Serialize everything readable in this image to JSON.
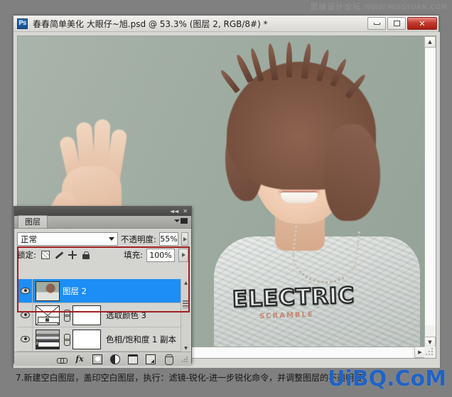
{
  "watermark_top": {
    "cn": "思缘设计论坛",
    "en": "WWW.MISSYUAN.COM"
  },
  "window": {
    "app_icon": "Ps",
    "title": "春春简单美化  大眼仔~旭.psd @ 53.3% (图层 2, RGB/8#) *",
    "controls": {
      "minimize": "minimize-button",
      "maximize": "maximize-button",
      "close": "✕"
    }
  },
  "document": {
    "zoom": "53.3%",
    "color_mode": "RGB/8#",
    "active_layer": "图层 2",
    "shirt_text": "ELECTRIC",
    "shirt_subtext": "SCRAMBLE"
  },
  "panel": {
    "tab_label": "图层",
    "collapse_icon": "◄◄",
    "close_icon": "✕",
    "blend_mode": "正常",
    "opacity_label": "不透明度:",
    "opacity_value": "55%",
    "lock_label": "锁定:",
    "fill_label": "填充:",
    "fill_value": "100%",
    "lock_icons": [
      "lock-transparent-pixels-icon",
      "lock-image-pixels-icon",
      "lock-position-icon",
      "lock-all-icon"
    ],
    "layers": [
      {
        "name": "图层 2",
        "visible": true,
        "selected": true,
        "kind": "pixel"
      },
      {
        "name": "选取颜色 3",
        "visible": true,
        "selected": false,
        "kind": "adjustment-selective-color"
      },
      {
        "name": "色相/饱和度 1 副本",
        "visible": true,
        "selected": false,
        "kind": "adjustment-hue-saturation"
      }
    ],
    "footer_buttons": [
      "link-layers-button",
      "layer-style-button",
      "add-layer-mask-button",
      "new-adjustment-layer-button",
      "new-group-button",
      "new-layer-button",
      "delete-layer-button"
    ],
    "footer_fx_label": "fx",
    "annotation_color": "#a02020"
  },
  "caption": {
    "text": "7.新建空白图层，盖印空白图层，执行：滤镜-锐化-进一步锐化命令，并调整图层的不透明度",
    "watermark": "UiBQ.CoM"
  }
}
